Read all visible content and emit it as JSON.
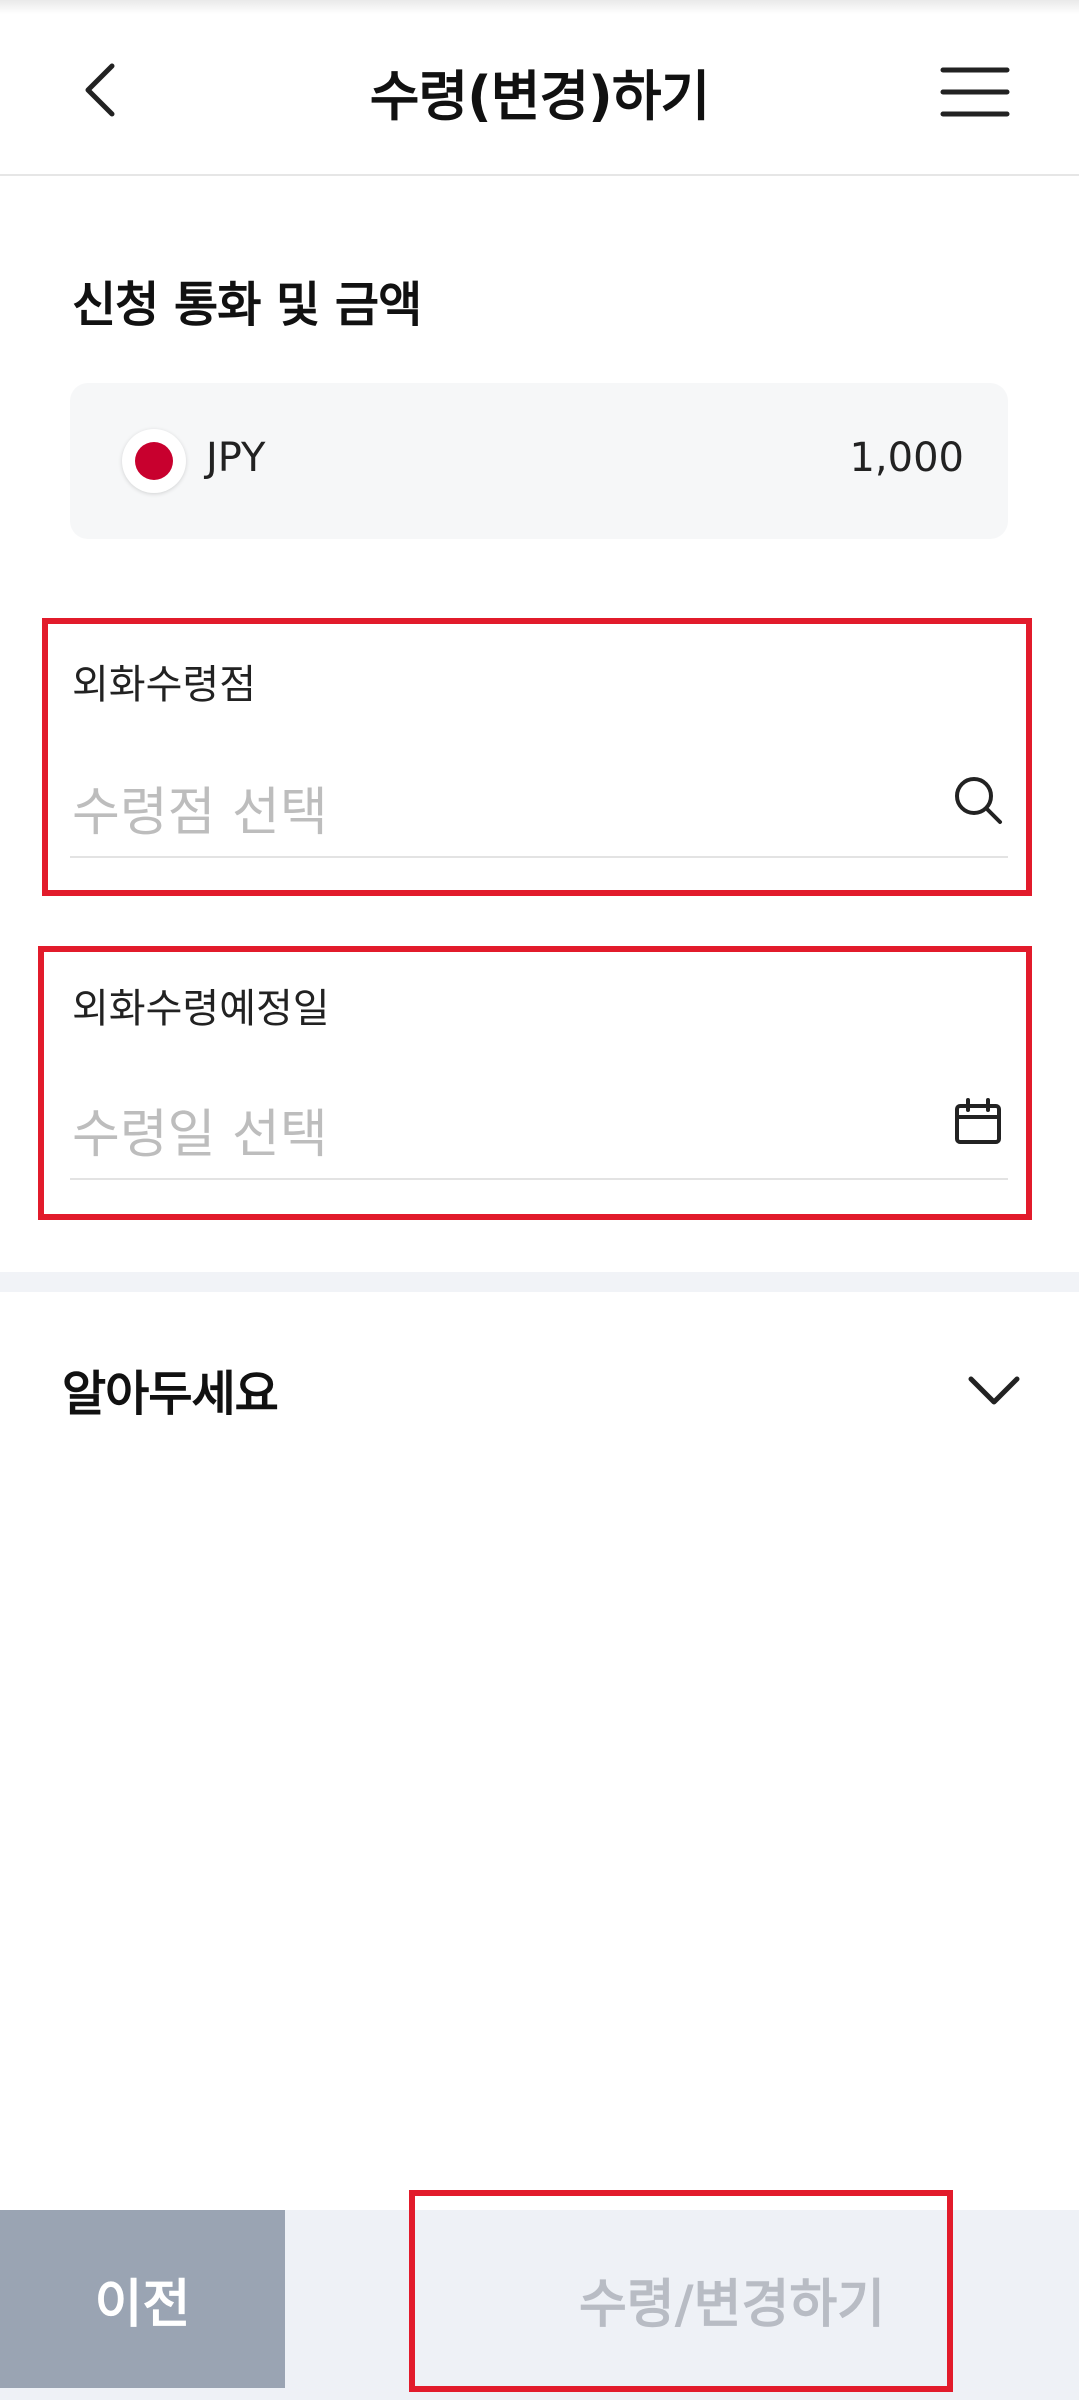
{
  "header": {
    "title": "수령(변경)하기",
    "back_icon": "chevron-left-icon",
    "menu_icon": "hamburger-menu-icon"
  },
  "currency_section": {
    "title": "신청 통화 및 금액",
    "currency_code": "JPY",
    "amount": "1,000",
    "flag": "japan-flag-icon"
  },
  "branch_field": {
    "label": "외화수령점",
    "placeholder": "수령점 선택",
    "icon": "search-icon"
  },
  "date_field": {
    "label": "외화수령예정일",
    "placeholder": "수령일 선택",
    "icon": "calendar-icon"
  },
  "notice": {
    "title": "알아두세요",
    "icon": "chevron-down-icon"
  },
  "bottom_bar": {
    "prev_label": "이전",
    "confirm_label": "수령/변경하기"
  },
  "colors": {
    "highlight": "#e21b2b",
    "flag_red": "#c8002e",
    "prev_button": "#9aa4b3",
    "placeholder": "#bdbdbd"
  }
}
